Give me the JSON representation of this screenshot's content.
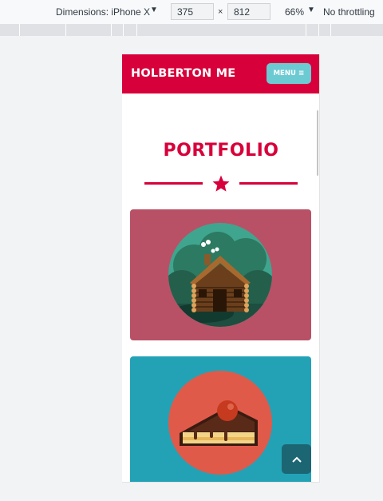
{
  "devtools": {
    "dimensions_label": "Dimensions: iPhone X",
    "width_value": "375",
    "height_value": "812",
    "times_symbol": "×",
    "zoom": "66%",
    "throttling": "No throttling"
  },
  "nav": {
    "brand": "HOLBERTON ME",
    "menu_label": "MENU"
  },
  "portfolio": {
    "title": "PORTFOLIO",
    "items": [
      {
        "name": "log-cabin",
        "bg": "#b85166"
      },
      {
        "name": "cake-slice",
        "bg": "#23a2b6"
      }
    ]
  },
  "colors": {
    "accent": "#d7003a",
    "menu_button": "#6ccad3",
    "back_to_top": "#1c6674"
  },
  "icons": {
    "menu": "bars-icon",
    "divider": "star-icon",
    "back_to_top": "chevron-up-icon"
  }
}
